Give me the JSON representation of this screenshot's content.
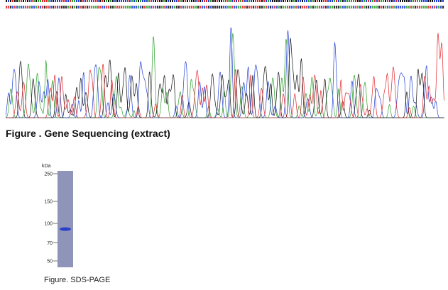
{
  "colors": {
    "base_A": "#2ca02c",
    "base_C": "#1f3fd6",
    "base_G": "#111111",
    "base_T": "#e0262b",
    "gel_lane": "#8f95b8",
    "gel_band": "#2a40c8"
  },
  "sequencing_figure": {
    "title": "Figure . Gene Sequencing (extract)"
  },
  "gel_figure": {
    "caption": "Figure. SDS-PAGE",
    "unit_label": "kDa",
    "markers": [
      {
        "label": "250",
        "kda": 250
      },
      {
        "label": "150",
        "kda": 150
      },
      {
        "label": "100",
        "kda": 100
      },
      {
        "label": "70",
        "kda": 70
      },
      {
        "label": "50",
        "kda": 50
      }
    ],
    "band_kda": 90
  }
}
